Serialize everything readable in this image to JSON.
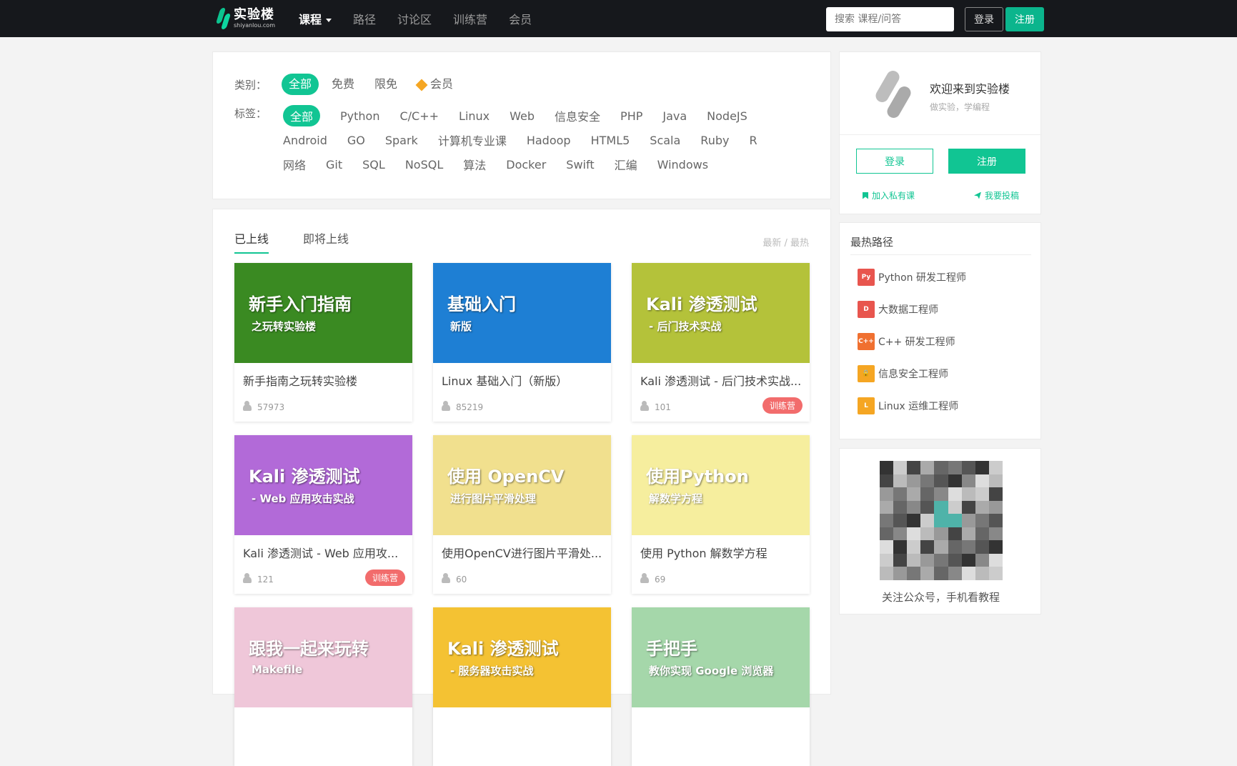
{
  "nav": {
    "logo_title": "实验楼",
    "logo_sub": "shiyanlou.com",
    "items": [
      "课程",
      "路径",
      "讨论区",
      "训练营",
      "会员"
    ],
    "search_placeholder": "搜索 课程/问答",
    "login": "登录",
    "register": "注册"
  },
  "filters": {
    "category_label": "类别：",
    "categories": [
      "全部",
      "免费",
      "限免",
      "会员"
    ],
    "tag_label": "标签：",
    "tag_rows": [
      [
        "全部",
        "Python",
        "C/C++",
        "Linux",
        "Web",
        "信息安全",
        "PHP",
        "Java",
        "NodeJS"
      ],
      [
        "Android",
        "GO",
        "Spark",
        "计算机专业课",
        "Hadoop",
        "HTML5",
        "Scala",
        "Ruby",
        "R"
      ],
      [
        "网络",
        "Git",
        "SQL",
        "NoSQL",
        "算法",
        "Docker",
        "Swift",
        "汇编",
        "Windows"
      ]
    ]
  },
  "courses": {
    "tabs": [
      "已上线",
      "即将上线"
    ],
    "sort": "最新 / 最热",
    "cards": [
      {
        "title": "新手指南之玩转实验楼",
        "count": "57973",
        "badge": "",
        "thumb_text": "新手入门指南",
        "thumb_sub": "之玩转实验楼",
        "color": "#3a8a22"
      },
      {
        "title": "Linux 基础入门（新版）",
        "count": "85219",
        "badge": "",
        "thumb_text": "基础入门",
        "thumb_sub": "新版",
        "color": "#1e7fd4"
      },
      {
        "title": "Kali 渗透测试 - 后门技术实战...",
        "count": "101",
        "badge": "训练营",
        "thumb_text": "Kali 渗透测试",
        "thumb_sub": "- 后门技术实战",
        "color": "#b4c23a"
      },
      {
        "title": "Kali 渗透测试 - Web 应用攻...",
        "count": "121",
        "badge": "训练营",
        "thumb_text": "Kali 渗透测试",
        "thumb_sub": "- Web 应用攻击实战",
        "color": "#b26ad8"
      },
      {
        "title": "使用OpenCV进行图片平滑处...",
        "count": "60",
        "badge": "",
        "thumb_text": "使用 OpenCV",
        "thumb_sub": "进行图片平滑处理",
        "color": "#f1e08e"
      },
      {
        "title": "使用 Python 解数学方程",
        "count": "69",
        "badge": "",
        "thumb_text": "使用Python",
        "thumb_sub": "解数学方程",
        "color": "#f6ee9e"
      },
      {
        "title": "",
        "count": "",
        "badge": "",
        "thumb_text": "跟我一起来玩转",
        "thumb_sub": "Makefile",
        "color": "#efc7d9"
      },
      {
        "title": "",
        "count": "",
        "badge": "",
        "thumb_text": "Kali 渗透测试",
        "thumb_sub": "- 服务器攻击实战",
        "color": "#f4c233"
      },
      {
        "title": "",
        "count": "",
        "badge": "",
        "thumb_text": "手把手",
        "thumb_sub": "教你实现 Google 浏览器",
        "color": "#a5d7aa"
      }
    ]
  },
  "welcome": {
    "title": "欢迎来到实验楼",
    "subtitle": "做实验，学编程",
    "login": "登录",
    "register": "注册",
    "link_left": "加入私有课",
    "link_right": "我要投稿"
  },
  "paths": {
    "title": "最热路径",
    "items": [
      {
        "label": "Python 研发工程师",
        "icon": "python-icon",
        "color": "#e8554e",
        "glyph": "Py"
      },
      {
        "label": "大数据工程师",
        "icon": "bigdata-icon",
        "color": "#e8554e",
        "glyph": "D"
      },
      {
        "label": "C++ 研发工程师",
        "icon": "cpp-icon",
        "color": "#f07030",
        "glyph": "C++"
      },
      {
        "label": "信息安全工程师",
        "icon": "lock-icon",
        "color": "#f5a623",
        "glyph": "🔒"
      },
      {
        "label": "Linux 运维工程师",
        "icon": "linux-icon",
        "color": "#f5a623",
        "glyph": "L"
      }
    ]
  },
  "qr": {
    "caption": "关注公众号，手机看教程"
  }
}
